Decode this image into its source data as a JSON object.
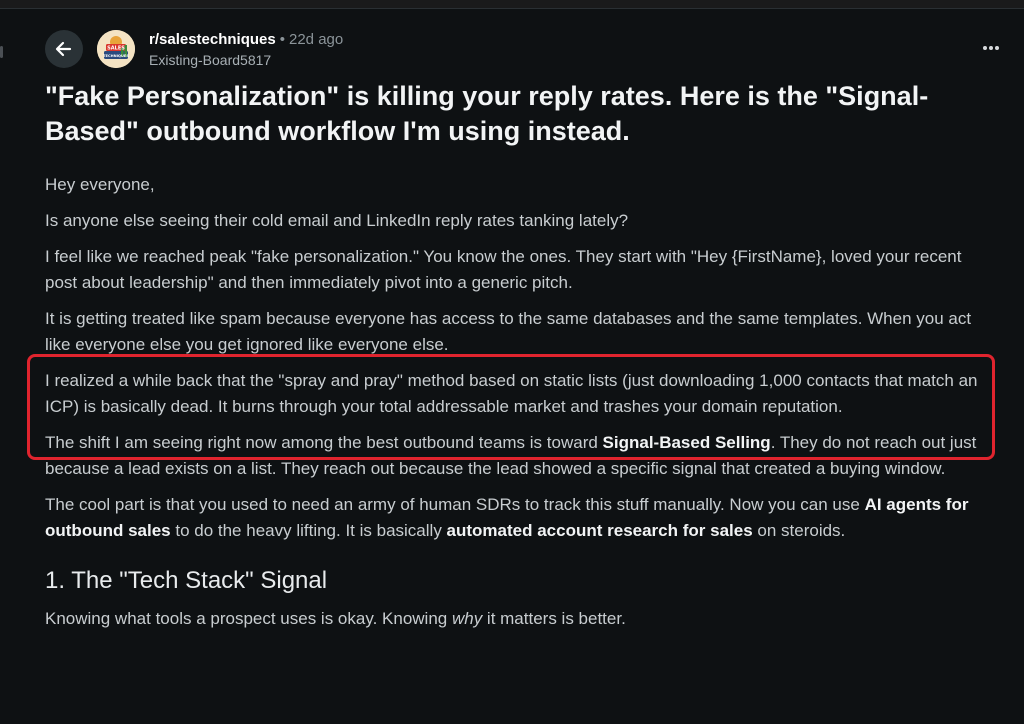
{
  "post": {
    "subreddit": "r/salestechniques",
    "separator": "•",
    "time_ago": "22d ago",
    "author": "Existing-Board5817",
    "title": "\"Fake Personalization\" is killing your reply rates. Here is the \"Signal-Based\" outbound workflow I'm using instead.",
    "avatar_text_top": "SALES",
    "avatar_text_bottom": "TECHNIQUES"
  },
  "body": {
    "p1": "Hey everyone,",
    "p2": "Is anyone else seeing their cold email and LinkedIn reply rates tanking lately?",
    "p3": "I feel like we reached peak \"fake personalization.\" You know the ones. They start with \"Hey {FirstName}, loved your recent post about leadership\" and then immediately pivot into a generic pitch.",
    "p4": "It is getting treated like spam because everyone has access to the same databases and the same templates. When you act like everyone else you get ignored like everyone else.",
    "p5": "I realized a while back that the \"spray and pray\" method based on static lists (just downloading 1,000 contacts that match an ICP) is basically dead. It burns through your total addressable market and trashes your domain reputation.",
    "p6_a": "The shift I am seeing right now among the best outbound teams is toward ",
    "p6_b": "Signal-Based Selling",
    "p6_c": ". They do not reach out just because a lead exists on a list. They reach out because the lead showed a specific signal that created a buying window.",
    "p7_a": "The cool part is that you used to need an army of human SDRs to track this stuff manually. Now you can use ",
    "p7_b": "AI agents for outbound sales",
    "p7_c": " to do the heavy lifting. It is basically ",
    "p7_d": "automated account research for sales",
    "p7_e": " on steroids.",
    "h1": "1. The \"Tech Stack\" Signal",
    "p8_a": "Knowing what tools a prospect uses is okay. Knowing ",
    "p8_b": "why",
    "p8_c": " it matters is better."
  },
  "colors": {
    "background": "#0e1113",
    "highlight": "#e0242e"
  },
  "icons": {
    "back": "arrow-left-icon",
    "more": "more-horizontal-icon"
  }
}
